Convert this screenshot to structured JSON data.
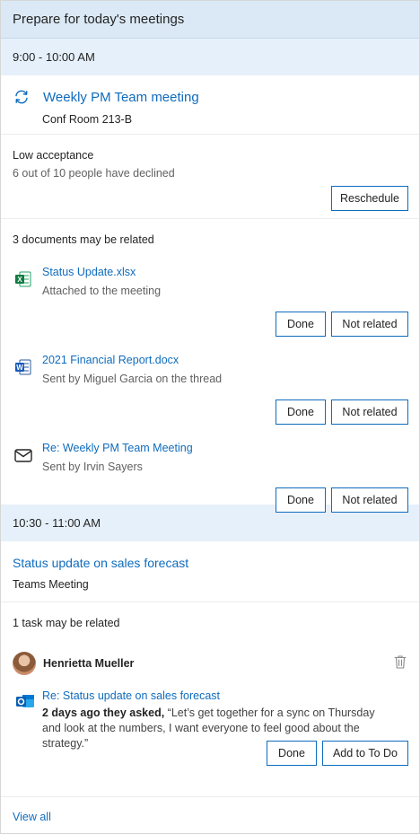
{
  "header": {
    "title": "Prepare for today's meetings"
  },
  "meeting1": {
    "time": "9:00 - 10:00 AM",
    "title": "Weekly PM Team meeting",
    "location": "Conf Room 213-B",
    "icon": "recurring-icon"
  },
  "acceptance": {
    "title": "Low acceptance",
    "detail": "6 out of 10 people have declined",
    "reschedule_label": "Reschedule"
  },
  "documents": {
    "heading": "3 documents may be related",
    "items": [
      {
        "icon": "excel-icon",
        "title": "Status Update.xlsx",
        "detail": "Attached to the meeting",
        "done_label": "Done",
        "not_related_label": "Not related"
      },
      {
        "icon": "word-icon",
        "title": "2021 Financial Report.docx",
        "detail": "Sent by Miguel Garcia on the thread",
        "done_label": "Done",
        "not_related_label": "Not related"
      },
      {
        "icon": "mail-icon",
        "title": "Re: Weekly PM Team Meeting",
        "detail": "Sent by Irvin Sayers",
        "done_label": "Done",
        "not_related_label": "Not related"
      }
    ]
  },
  "meeting2": {
    "time": "10:30 - 11:00 AM",
    "title": "Status update on sales forecast",
    "location": "Teams Meeting"
  },
  "tasks": {
    "heading": "1 task may be related",
    "person": "Henrietta Mueller",
    "title": "Re: Status update on sales forecast",
    "asked_prefix": "2 days ago they asked,",
    "quote": " “Let’s get together for a sync on Thursday and look at the numbers, I want everyone to feel good about the strategy.”",
    "done_label": "Done",
    "add_label": "Add to To Do"
  },
  "footer": {
    "view_all": "View all"
  },
  "colors": {
    "accent": "#0f6cbd",
    "header_bg": "#dbe9f6",
    "time_bg": "#e6f0fa"
  }
}
